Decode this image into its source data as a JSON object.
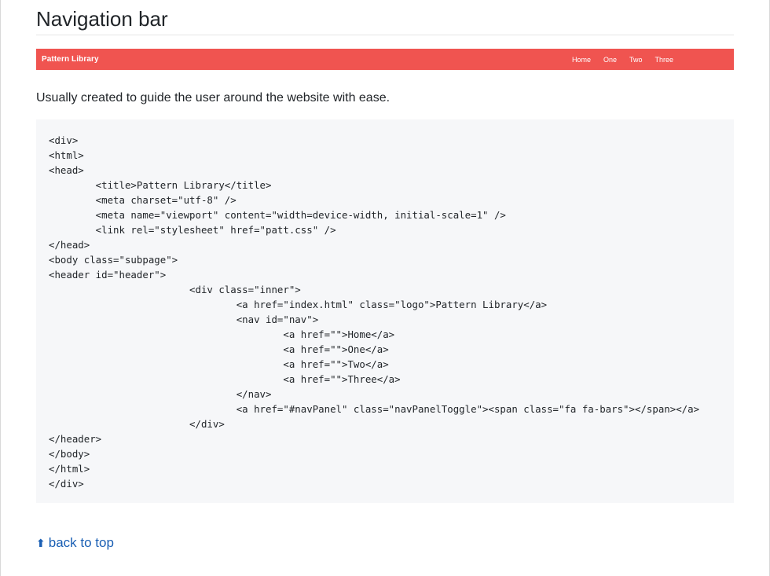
{
  "section": {
    "title": "Navigation bar",
    "description": "Usually created to guide the user around the website with ease."
  },
  "demo_nav": {
    "logo": "Pattern Library",
    "links": [
      "Home",
      "One",
      "Two",
      "Three"
    ],
    "background_color": "#f05450"
  },
  "code": {
    "lines": [
      "<div>",
      "<html>",
      "<head>",
      "        <title>Pattern Library</title>",
      "        <meta charset=\"utf-8\" />",
      "        <meta name=\"viewport\" content=\"width=device-width, initial-scale=1\" />",
      "        <link rel=\"stylesheet\" href=\"patt.css\" />",
      "</head>",
      "<body class=\"subpage\">",
      "<header id=\"header\">",
      "                        <div class=\"inner\">",
      "                                <a href=\"index.html\" class=\"logo\">Pattern Library</a>",
      "                                <nav id=\"nav\">",
      "                                        <a href=\"\">Home</a>",
      "                                        <a href=\"\">One</a>",
      "                                        <a href=\"\">Two</a>",
      "                                        <a href=\"\">Three</a>",
      "                                </nav>",
      "                                <a href=\"#navPanel\" class=\"navPanelToggle\"><span class=\"fa fa-bars\"></span></a>",
      "                        </div>",
      "</header>",
      "</body>",
      "</html>",
      "</div>"
    ]
  },
  "footer": {
    "back_to_top": "back to top",
    "arrow_icon": "up-arrow-icon",
    "link_color": "#1a5fb4"
  }
}
